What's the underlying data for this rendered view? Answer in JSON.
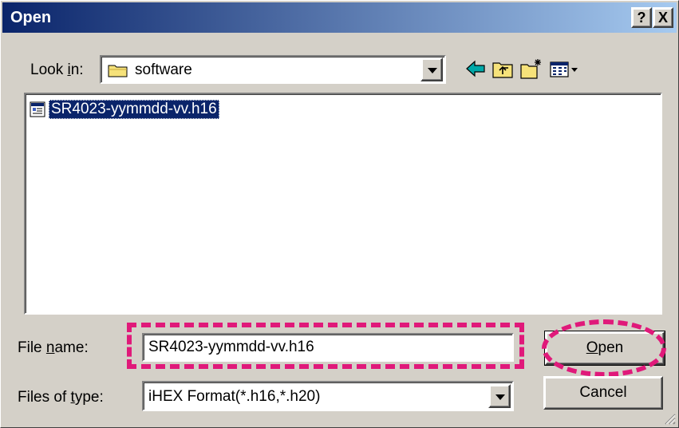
{
  "window": {
    "title": "Open",
    "help_label": "?",
    "close_label": "X",
    "titlebar_gradient": [
      "#0a246a",
      "#a6caf0"
    ]
  },
  "look_in": {
    "label_pre": "Look ",
    "label_underline": "i",
    "label_post": "n:",
    "value": "software",
    "icon": "folder-icon"
  },
  "toolbar": {
    "icons": [
      "back-arrow-icon",
      "up-folder-icon",
      "new-folder-icon",
      "view-menu-icon"
    ]
  },
  "file_list": {
    "items": [
      {
        "name": "SR4023-yymmdd-vv.h16",
        "icon": "file-icon",
        "selected": true
      }
    ]
  },
  "file_name": {
    "label_pre": "File ",
    "label_underline": "n",
    "label_post": "ame:",
    "value": "SR4023-yymmdd-vv.h16"
  },
  "file_type": {
    "label_pre": "Files of ",
    "label_underline": "t",
    "label_post": "ype:",
    "value": "iHEX Format(*.h16,*.h20)"
  },
  "buttons": {
    "open_underline": "O",
    "open_rest": "pen",
    "cancel": "Cancel"
  },
  "annotation": {
    "highlight_color": "#e0197a"
  },
  "colors": {
    "face": "#d4d0c8",
    "selection": "#0a246a"
  }
}
